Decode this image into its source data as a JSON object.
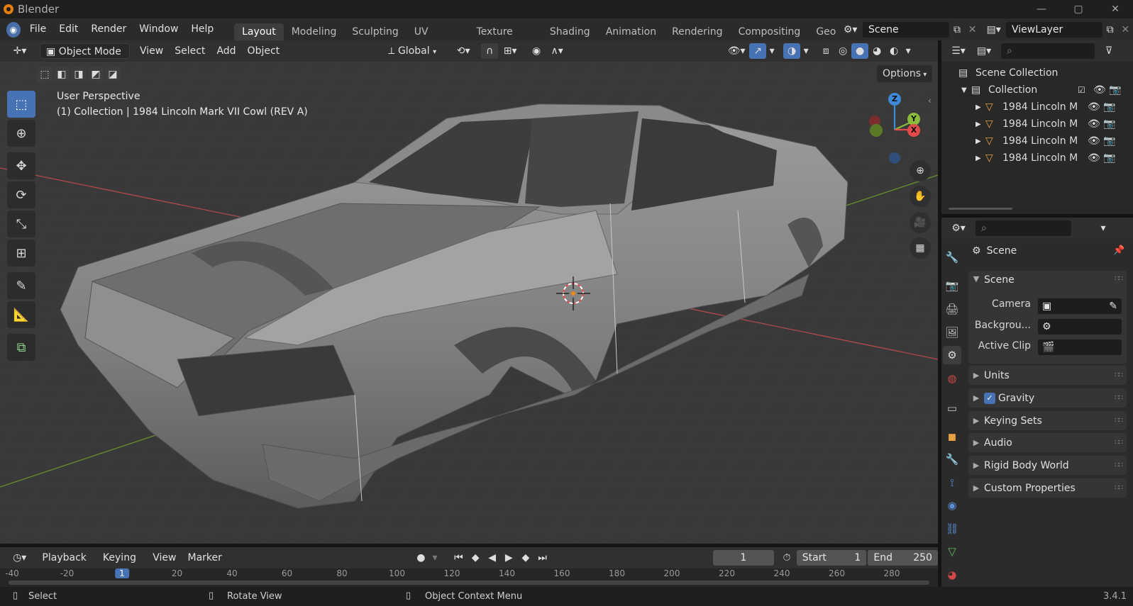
{
  "window": {
    "title": "Blender",
    "min_icon": "—",
    "max_icon": "▢",
    "close_icon": "✕"
  },
  "menus": [
    "File",
    "Edit",
    "Render",
    "Window",
    "Help"
  ],
  "workspaces": [
    "Layout",
    "Modeling",
    "Sculpting",
    "UV Editing",
    "Texture Paint",
    "Shading",
    "Animation",
    "Rendering",
    "Compositing",
    "Geo"
  ],
  "active_workspace": "Layout",
  "scene_name": "Scene",
  "view_layer": "ViewLayer",
  "viewport_header": {
    "mode": "Object Mode",
    "menus": [
      "View",
      "Select",
      "Add",
      "Object"
    ],
    "orientation": "Global",
    "options_label": "Options"
  },
  "viewport": {
    "perspective": "User Perspective",
    "collection_info": "(1) Collection | 1984 Lincoln Mark VII Cowl (REV A)",
    "gizmo": {
      "z": "Z",
      "y": "Y",
      "x": "X"
    },
    "colors": {
      "x_axis": "#e34a4a",
      "y_axis": "#8bbb3c",
      "z_axis": "#3d8ad6",
      "bg": "#393939"
    }
  },
  "outliner": {
    "root": "Scene Collection",
    "collection": "Collection",
    "objects": [
      "1984 Lincoln M",
      "1984 Lincoln M",
      "1984 Lincoln M",
      "1984 Lincoln M"
    ]
  },
  "properties": {
    "header": "Scene",
    "section": "Scene",
    "fields": [
      {
        "label": "Camera"
      },
      {
        "label": "Backgrou..."
      },
      {
        "label": "Active Clip"
      }
    ],
    "panels": [
      "Units",
      "Gravity",
      "Keying Sets",
      "Audio",
      "Rigid Body World",
      "Custom Properties"
    ],
    "tabs": [
      "tool-icon",
      "render-icon",
      "output-icon",
      "view-layer-icon",
      "scene-icon",
      "world-icon",
      "collection-icon",
      "object-icon",
      "modifier-icon",
      "particles-icon",
      "physics-icon",
      "constraints-icon",
      "data-icon",
      "material-icon"
    ]
  },
  "timeline": {
    "menus": [
      "Playback",
      "Keying",
      "View",
      "Marker"
    ],
    "current_frame": "1",
    "start_label": "Start",
    "start": "1",
    "end_label": "End",
    "end": "250",
    "ruler": [
      "-40",
      "-20",
      "1",
      "20",
      "40",
      "60",
      "80",
      "100",
      "120",
      "140",
      "160",
      "180",
      "200",
      "220",
      "240",
      "260",
      "280"
    ]
  },
  "status": {
    "select": "Select",
    "rotate": "Rotate View",
    "context": "Object Context Menu",
    "version": "3.4.1"
  }
}
